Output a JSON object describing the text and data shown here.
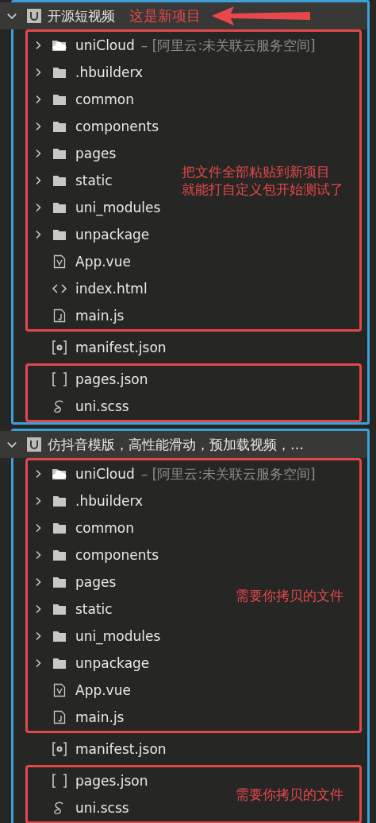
{
  "projects": [
    {
      "name": "开源短视频",
      "expanded": true,
      "callout": "这是新项目",
      "sections": [
        {
          "boxed": true,
          "note_lines": [
            "把文件全部粘贴到新项目",
            "就能打自定义包开始测试了"
          ],
          "items": [
            {
              "kind": "cloud",
              "name": "uniCloud",
              "detail": "– [阿里云:未关联云服务空间]",
              "expanded": false
            },
            {
              "kind": "folder",
              "name": ".hbuilderx",
              "expanded": false
            },
            {
              "kind": "folder",
              "name": "common",
              "expanded": false
            },
            {
              "kind": "folder",
              "name": "components",
              "expanded": false
            },
            {
              "kind": "folder",
              "name": "pages",
              "expanded": false
            },
            {
              "kind": "folder",
              "name": "static",
              "expanded": false
            },
            {
              "kind": "folder",
              "name": "uni_modules",
              "expanded": false
            },
            {
              "kind": "folder",
              "name": "unpackage",
              "expanded": false
            },
            {
              "kind": "vue",
              "name": "App.vue"
            },
            {
              "kind": "html",
              "name": "index.html"
            },
            {
              "kind": "js",
              "name": "main.js"
            }
          ]
        },
        {
          "boxed": false,
          "items": [
            {
              "kind": "manifest",
              "name": "manifest.json"
            }
          ]
        },
        {
          "boxed": true,
          "items": [
            {
              "kind": "json",
              "name": "pages.json"
            },
            {
              "kind": "scss",
              "name": "uni.scss"
            }
          ]
        }
      ]
    },
    {
      "name": "仿抖音模版，高性能滑动，预加载视频，…",
      "expanded": true,
      "sections": [
        {
          "boxed": true,
          "note_lines": [
            "需要你拷贝的文件"
          ],
          "items": [
            {
              "kind": "cloud",
              "name": "uniCloud",
              "detail": "– [阿里云:未关联云服务空间]",
              "expanded": false
            },
            {
              "kind": "folder",
              "name": ".hbuilderx",
              "expanded": false
            },
            {
              "kind": "folder",
              "name": "common",
              "expanded": false
            },
            {
              "kind": "folder",
              "name": "components",
              "expanded": false
            },
            {
              "kind": "folder",
              "name": "pages",
              "expanded": false
            },
            {
              "kind": "folder",
              "name": "static",
              "expanded": false
            },
            {
              "kind": "folder",
              "name": "uni_modules",
              "expanded": false
            },
            {
              "kind": "folder",
              "name": "unpackage",
              "expanded": false
            },
            {
              "kind": "vue",
              "name": "App.vue"
            },
            {
              "kind": "js",
              "name": "main.js"
            }
          ]
        },
        {
          "boxed": false,
          "items": [
            {
              "kind": "manifest",
              "name": "manifest.json"
            }
          ]
        },
        {
          "boxed": true,
          "note_lines": [
            "需要你拷贝的文件"
          ],
          "items": [
            {
              "kind": "json",
              "name": "pages.json"
            },
            {
              "kind": "scss",
              "name": "uni.scss"
            }
          ]
        }
      ]
    }
  ]
}
